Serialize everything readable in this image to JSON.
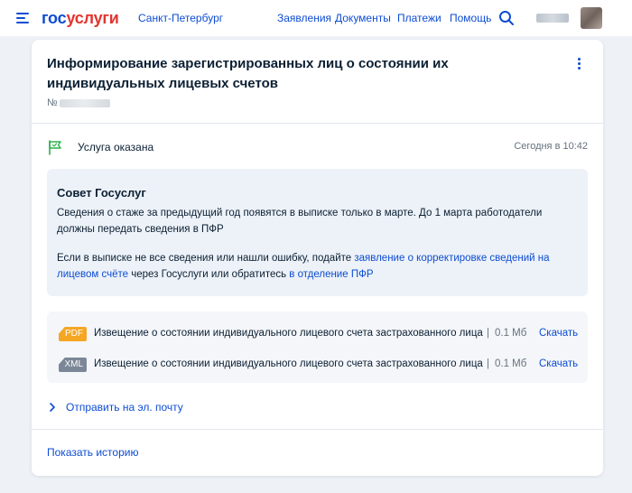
{
  "header": {
    "logo_part1": "гос",
    "logo_part2": "услуги",
    "city": "Санкт-Петербург",
    "nav": [
      "Заявления",
      "Документы",
      "Платежи",
      "Помощь"
    ],
    "icons": [
      "menu-icon",
      "search-icon"
    ]
  },
  "card": {
    "title": "Информирование зарегистрированных лиц о состоянии их индивидуальных лицевых счетов",
    "number_label": "№",
    "status": {
      "label": "Услуга оказана",
      "time": "Сегодня в 10:42",
      "icon": "flag-icon"
    },
    "tip": {
      "title": "Совет Госуслуг",
      "p1": "Сведения о стаже за предыдущий год появятся в выписке только в марте. До 1 марта работодатели должны передать сведения в ПФР",
      "p2_before": "Если в выписке не все сведения или нашли ошибку, подайте ",
      "p2_link1": "заявление о корректировке сведений на лицевом счёте",
      "p2_middle": " через Госуслуги или обратитесь ",
      "p2_link2": "в отделение ПФР"
    },
    "files": [
      {
        "type": "PDF",
        "name": "Извещение о состоянии индивидуального лицевого счета застрахованного лица ...",
        "sep": "|",
        "size": "0.1 Мб",
        "action": "Скачать"
      },
      {
        "type": "XML",
        "name": "Извещение о состоянии индивидуального лицевого счета застрахованного лица ...",
        "sep": "|",
        "size": "0.1 Мб",
        "action": "Скачать"
      }
    ],
    "send_email": "Отправить на эл. почту",
    "show_history": "Показать историю"
  },
  "colors": {
    "accent": "#0d4cd3",
    "logo_red": "#e3342f",
    "pdf_badge": "#f5a623",
    "xml_badge": "#7b8796",
    "status_flag": "#2bb24c",
    "page_bg": "#eef2f7"
  }
}
